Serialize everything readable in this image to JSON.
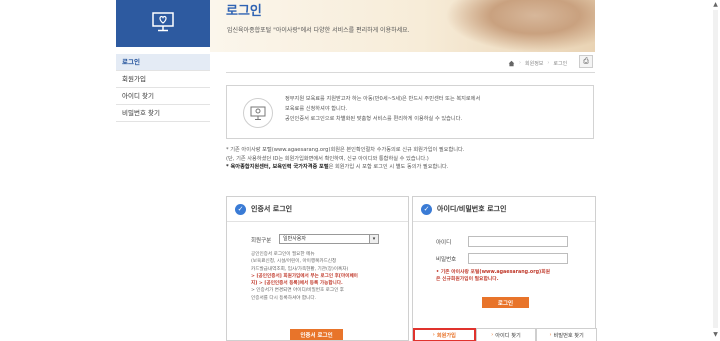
{
  "banner": {
    "title": "로그인",
    "subtitle": "임신육아종합포털 \"아이사랑\"에서 다양한 서비스를 편리하게 이용하세요."
  },
  "sidebar": {
    "items": [
      {
        "label": "로그인",
        "active": true
      },
      {
        "label": "회원가입",
        "active": false
      },
      {
        "label": "아이디 찾기",
        "active": false
      },
      {
        "label": "비밀번호 찾기",
        "active": false
      }
    ]
  },
  "breadcrumb": {
    "items": [
      "회원정보",
      "로그인"
    ]
  },
  "info": {
    "line1": "정부지원 보육료를 지원받고자 하는 아동(만0세~5세)은 반드시 주민센터 또는 복지로에서",
    "line2": "보육료를 신청하셔야 합니다.",
    "line3": "공인인증서 로그인으로 차별화된 맞춤형 서비스를 편리하게 이용하실 수 있습니다."
  },
  "notes": {
    "line1": "* 기존 아이사랑 포털(www.agaesarang.org)회원은 본인확인절차 수가동의로 신규 회원가입이 필요합니다.",
    "line2": "(단, 기존 사용하셨던 ID는 회원가입화면에서 확인하여, 신규 아이디와 통합하실 수 있습니다.)",
    "line3_strong": "* 육아종합지원센터, 보육인력 국가자격증 포털",
    "line3_rest": "은 회원가입 시 포함 로그인 시 별도 동의가 필요합니다."
  },
  "cert_panel": {
    "title": "인증서 로그인",
    "member_type_label": "회원구분",
    "member_type_value": "일반사용자",
    "notes": [
      {
        "text": "공인인증서 로그인이 필요한 메뉴",
        "red": false
      },
      {
        "text": "(보육료신청, 시설/어린이, 아이행복카드신청",
        "red": false
      },
      {
        "text": "카드발급내역조회, 입사/가족현황, 기관(장)이혹자)",
        "red": false
      },
      {
        "text": "> [공인인증서] 회원가입에서 부는 로그인 후[마이페이",
        "red": true
      },
      {
        "text": "지] > [공인인증서 등록]에서 등록 가능합니다.",
        "red": true
      },
      {
        "text": "> 인증서가 변경되면 아이디/비밀번호 로그인 후",
        "red": false
      },
      {
        "text": "인증서를 다시 등록하셔야 합니다.",
        "red": false
      }
    ],
    "button_label": "인증서 로그인"
  },
  "id_panel": {
    "title": "아이디/비밀번호 로그인",
    "id_label": "아이디",
    "password_label": "비밀번호",
    "note_line1": "• 기존 아이사랑 포털(www.agaesarang.org)회원",
    "note_line2": "은 신규회원가입이 필요합니다.",
    "login_button": "로그인",
    "tabs": {
      "join": "회원가입",
      "find_id": "아이디 찾기",
      "find_password": "비밀번호 찾기"
    }
  },
  "colors": {
    "brand_blue": "#2d5aa0",
    "accent_orange": "#e8742a",
    "highlight_red": "#e0332d"
  }
}
